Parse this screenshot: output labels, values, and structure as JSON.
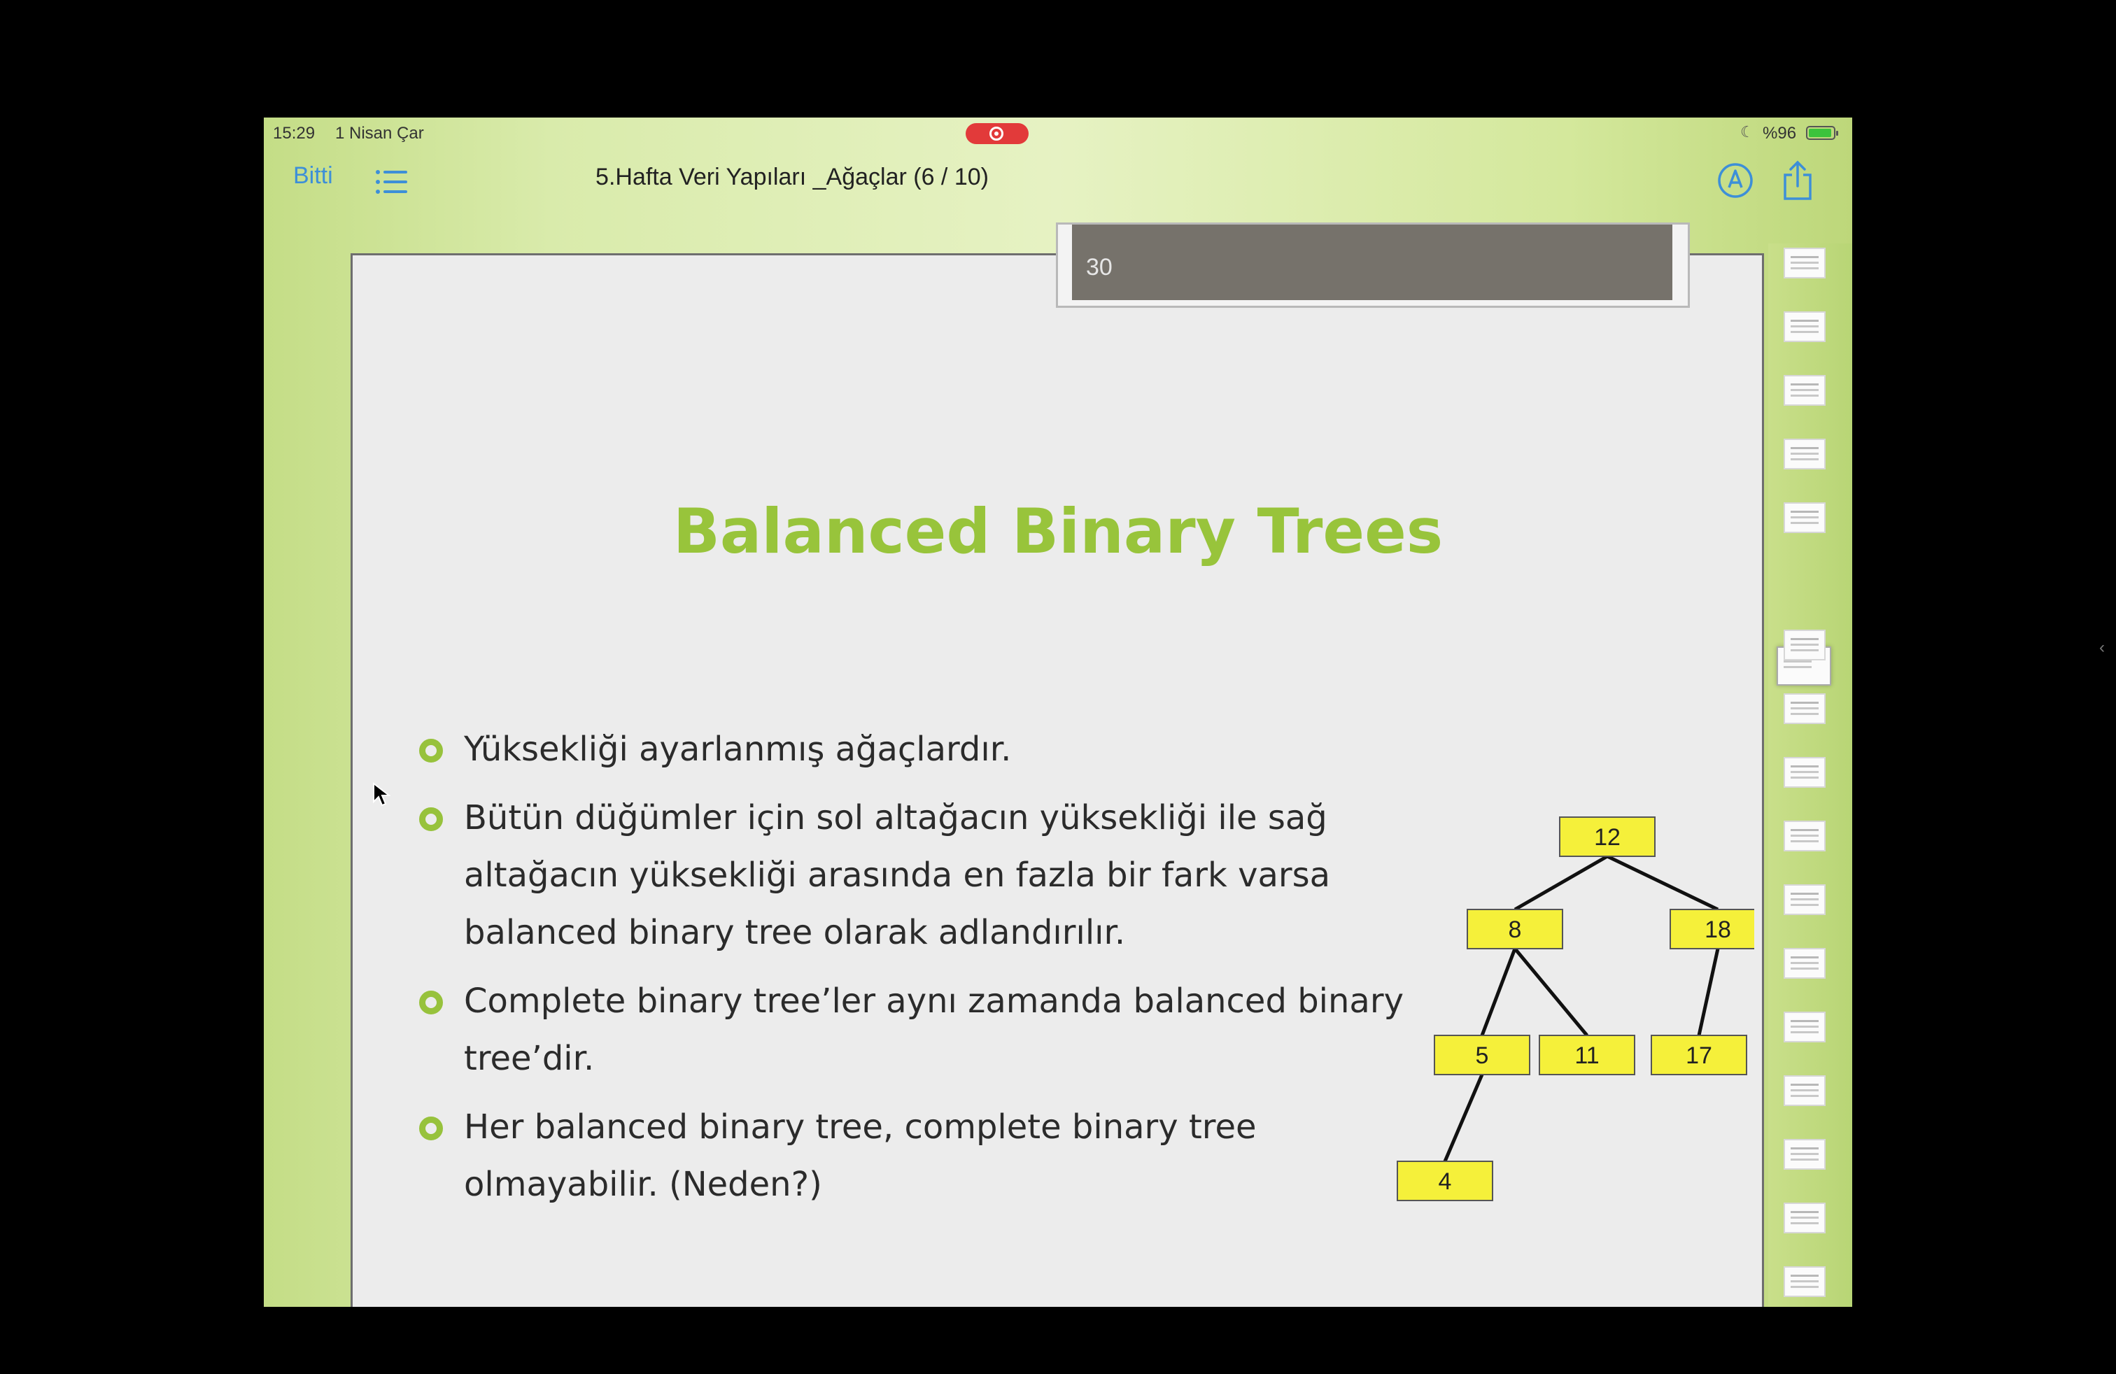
{
  "status_bar": {
    "time": "15:29",
    "date": "1 Nisan Çar",
    "battery": "%96"
  },
  "toolbar": {
    "done_label": "Bitti",
    "title": "5.Hafta Veri Yapıları _Ağaçlar (6 / 10)"
  },
  "slide": {
    "number": "30",
    "title": "Balanced Binary Trees",
    "bullets": [
      "Yüksekliği ayarlanmış ağaçlardır.",
      "Bütün düğümler için sol altağacın yüksekliği ile sağ altağacın yüksekliği arasında en fazla bir fark varsa balanced binary tree olarak adlandırılır.",
      "Complete binary tree’ler aynı zamanda balanced binary tree’dir.",
      "Her balanced binary tree, complete binary tree olmayabilir. (Neden?)"
    ],
    "tree": {
      "nodes": [
        "12",
        "8",
        "18",
        "5",
        "11",
        "17",
        "4"
      ],
      "edges": [
        [
          "12",
          "8"
        ],
        [
          "12",
          "18"
        ],
        [
          "8",
          "5"
        ],
        [
          "8",
          "11"
        ],
        [
          "18",
          "17"
        ],
        [
          "5",
          "4"
        ]
      ]
    }
  },
  "colors": {
    "accent": "#98c43b",
    "node_fill": "#f5f03a",
    "link": "#3d8fd8"
  },
  "icons": [
    "list-icon",
    "markup-icon",
    "share-icon",
    "record-icon",
    "moon-icon",
    "battery-icon",
    "chevron-left-icon"
  ]
}
